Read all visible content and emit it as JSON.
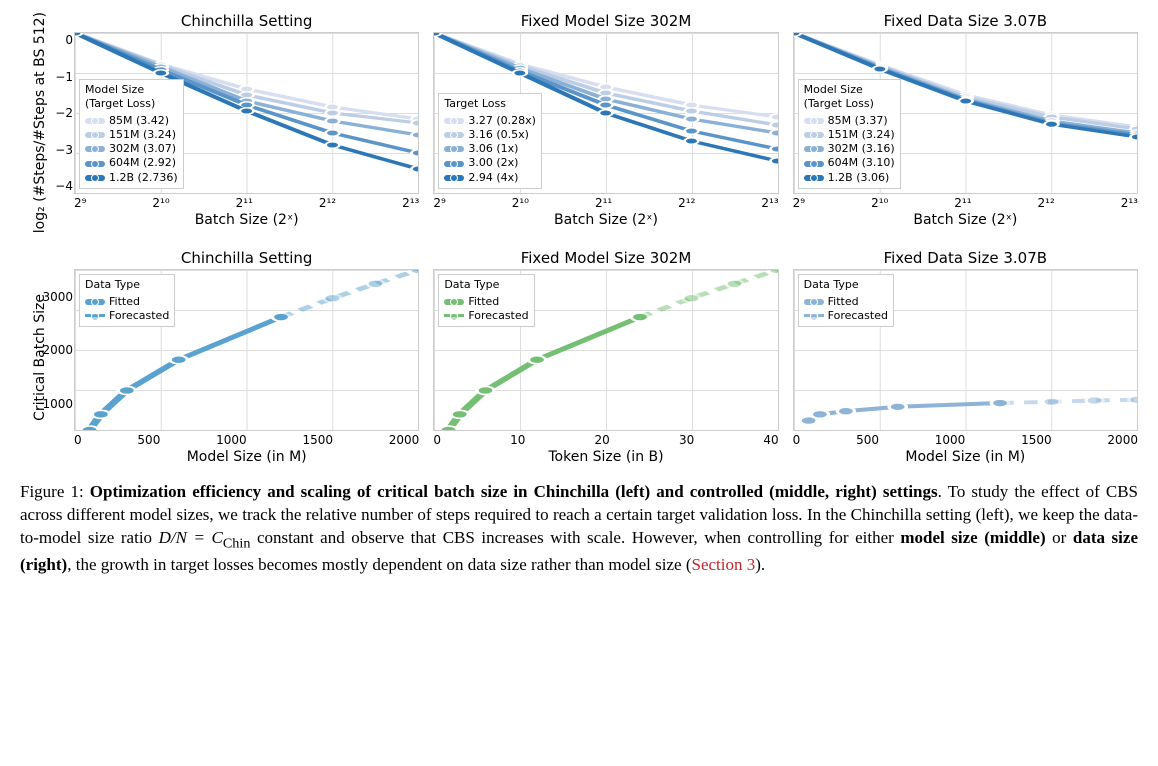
{
  "chart_data": [
    {
      "type": "line",
      "title": "Chinchilla Setting",
      "xlabel": "Batch Size (2ˣ)",
      "ylabel": "log₂ (#Steps/#Steps at BS 512)",
      "xlim": [
        9,
        13
      ],
      "ylim": [
        -4,
        0
      ],
      "legend_title": "Model Size\n(Target Loss)",
      "series": [
        {
          "name": "85M (3.42)",
          "color": "#d6def0",
          "x": [
            9,
            10,
            11,
            12,
            13
          ],
          "y": [
            0,
            -0.78,
            -1.4,
            -1.85,
            -2.15
          ]
        },
        {
          "name": "151M (3.24)",
          "color": "#bccde6",
          "x": [
            9,
            10,
            11,
            12,
            13
          ],
          "y": [
            0,
            -0.8,
            -1.55,
            -2.0,
            -2.25
          ]
        },
        {
          "name": "302M (3.07)",
          "color": "#8ab0d6",
          "x": [
            9,
            10,
            11,
            12,
            13
          ],
          "y": [
            0,
            -0.85,
            -1.7,
            -2.2,
            -2.55
          ]
        },
        {
          "name": "604M (2.92)",
          "color": "#5a94c8",
          "x": [
            9,
            10,
            11,
            12,
            13
          ],
          "y": [
            0,
            -0.92,
            -1.8,
            -2.5,
            -3.0
          ]
        },
        {
          "name": "1.2B (2.736)",
          "color": "#2d77b6",
          "x": [
            9,
            10,
            11,
            12,
            13
          ],
          "y": [
            0,
            -1.0,
            -1.95,
            -2.8,
            -3.4
          ]
        }
      ]
    },
    {
      "type": "line",
      "title": "Fixed Model Size 302M",
      "xlabel": "Batch Size (2ˣ)",
      "xlim": [
        9,
        13
      ],
      "ylim": [
        -4,
        0
      ],
      "legend_title": "Target Loss",
      "series": [
        {
          "name": "3.27 (0.28x)",
          "color": "#d6def0",
          "x": [
            9,
            10,
            11,
            12,
            13
          ],
          "y": [
            0,
            -0.78,
            -1.35,
            -1.8,
            -2.1
          ]
        },
        {
          "name": "3.16 (0.5x)",
          "color": "#bccde6",
          "x": [
            9,
            10,
            11,
            12,
            13
          ],
          "y": [
            0,
            -0.82,
            -1.5,
            -1.95,
            -2.3
          ]
        },
        {
          "name": "3.06 (1x)",
          "color": "#8ab0d6",
          "x": [
            9,
            10,
            11,
            12,
            13
          ],
          "y": [
            0,
            -0.88,
            -1.65,
            -2.15,
            -2.5
          ]
        },
        {
          "name": "3.00 (2x)",
          "color": "#5a94c8",
          "x": [
            9,
            10,
            11,
            12,
            13
          ],
          "y": [
            0,
            -0.95,
            -1.8,
            -2.45,
            -2.9
          ]
        },
        {
          "name": "2.94 (4x)",
          "color": "#2d77b6",
          "x": [
            9,
            10,
            11,
            12,
            13
          ],
          "y": [
            0,
            -1.0,
            -2.0,
            -2.7,
            -3.2
          ]
        }
      ]
    },
    {
      "type": "line",
      "title": "Fixed Data Size 3.07B",
      "xlabel": "Batch Size (2ˣ)",
      "xlim": [
        9,
        13
      ],
      "ylim": [
        -4,
        0
      ],
      "legend_title": "Model Size\n(Target Loss)",
      "series": [
        {
          "name": "85M (3.37)",
          "color": "#d6def0",
          "x": [
            9,
            10,
            11,
            12,
            13
          ],
          "y": [
            0,
            -0.8,
            -1.55,
            -2.05,
            -2.35
          ]
        },
        {
          "name": "151M (3.24)",
          "color": "#bccde6",
          "x": [
            9,
            10,
            11,
            12,
            13
          ],
          "y": [
            0,
            -0.82,
            -1.6,
            -2.1,
            -2.4
          ]
        },
        {
          "name": "302M (3.16)",
          "color": "#8ab0d6",
          "x": [
            9,
            10,
            11,
            12,
            13
          ],
          "y": [
            0,
            -0.85,
            -1.65,
            -2.2,
            -2.5
          ]
        },
        {
          "name": "604M (3.10)",
          "color": "#5a94c8",
          "x": [
            9,
            10,
            11,
            12,
            13
          ],
          "y": [
            0,
            -0.88,
            -1.68,
            -2.25,
            -2.55
          ]
        },
        {
          "name": "1.2B (3.06)",
          "color": "#2d77b6",
          "x": [
            9,
            10,
            11,
            12,
            13
          ],
          "y": [
            0,
            -0.9,
            -1.7,
            -2.28,
            -2.6
          ]
        }
      ]
    },
    {
      "type": "line",
      "title": "Chinchilla Setting",
      "xlabel": "Model Size (in M)",
      "ylabel": "Critical Batch Size",
      "xlim": [
        0,
        2000
      ],
      "ylim": [
        750,
        3300
      ],
      "color": "#5aa3d0",
      "legend_title": "Data Type",
      "fitted": {
        "x": [
          85,
          151,
          302,
          604,
          1200
        ],
        "y": [
          750,
          1000,
          1380,
          1870,
          2550
        ]
      },
      "forecasted": {
        "x": [
          1200,
          1500,
          1750,
          2000
        ],
        "y": [
          2550,
          2850,
          3080,
          3300
        ]
      }
    },
    {
      "type": "line",
      "title": "Fixed Model Size 302M",
      "xlabel": "Token Size (in B)",
      "xlim": [
        0,
        40
      ],
      "ylim": [
        750,
        3300
      ],
      "color": "#74bf74",
      "legend_title": "Data Type",
      "fitted": {
        "x": [
          1.7,
          3.0,
          6.0,
          12.0,
          24.0
        ],
        "y": [
          750,
          1000,
          1380,
          1870,
          2550
        ]
      },
      "forecasted": {
        "x": [
          24.0,
          30,
          35,
          40
        ],
        "y": [
          2550,
          2850,
          3080,
          3300
        ]
      }
    },
    {
      "type": "line",
      "title": "Fixed Data Size 3.07B",
      "xlabel": "Model Size (in M)",
      "xlim": [
        0,
        2000
      ],
      "ylim": [
        750,
        3300
      ],
      "color": "#8db3d6",
      "legend_title": "Data Type",
      "fitted": {
        "x": [
          85,
          151,
          302,
          604,
          1200
        ],
        "y": [
          900,
          1000,
          1050,
          1120,
          1180
        ]
      },
      "forecasted": {
        "x": [
          1200,
          1500,
          1750,
          2000
        ],
        "y": [
          1180,
          1200,
          1220,
          1230
        ]
      }
    }
  ],
  "row1_xticks": [
    "2⁹",
    "2¹⁰",
    "2¹¹",
    "2¹²",
    "2¹³"
  ],
  "row1_yticks": [
    "0",
    "−1",
    "−2",
    "−3",
    "−4"
  ],
  "row2_yticks": [
    "3000",
    "2000",
    "1000"
  ],
  "row2_xticks": {
    "0": [
      "0",
      "500",
      "1000",
      "1500",
      "2000"
    ],
    "1": [
      "0",
      "10",
      "20",
      "30",
      "40"
    ],
    "2": [
      "0",
      "500",
      "1000",
      "1500",
      "2000"
    ]
  },
  "row2_legend": {
    "fitted": "Fitted",
    "forecasted": "Forecasted"
  },
  "caption": {
    "label": "Figure 1:",
    "bold": "Optimization efficiency and scaling of critical batch size in Chinchilla (left) and controlled (middle, right) settings",
    "body1": ". To study the effect of CBS across different model sizes, we track the relative number of steps required to reach a certain target validation loss. In the Chinchilla setting (left), we keep the data-to-model size ratio ",
    "math": "D/N = C",
    "subscript": "Chin",
    "body2": " constant and observe that CBS increases with scale. However, when controlling for either ",
    "bold2": "model size (middle)",
    "body3": " or ",
    "bold3": "data size (right)",
    "body4": ", the growth in target losses becomes mostly dependent on data size rather than model size (",
    "link": "Section 3",
    "body5": ")."
  }
}
